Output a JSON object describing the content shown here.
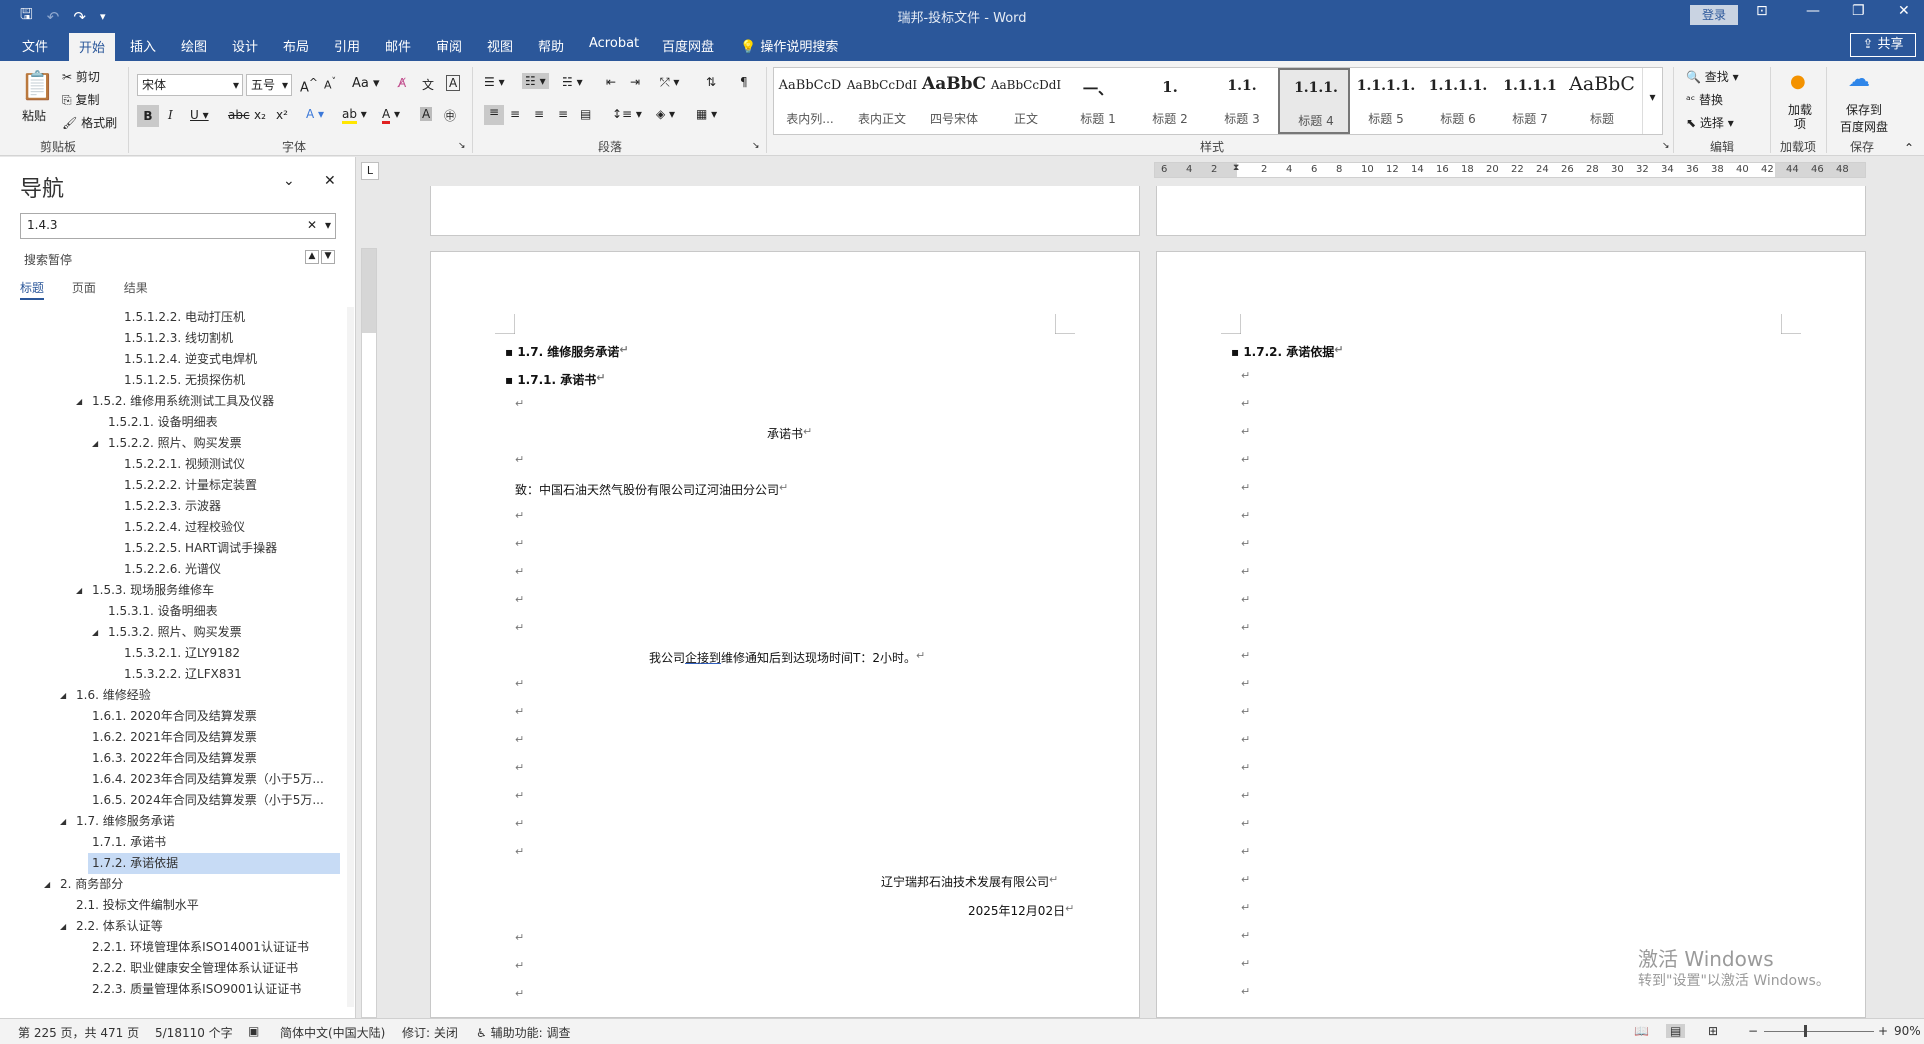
{
  "titlebar": {
    "title": "瑞邦-投标文件 - Word",
    "login": "登录"
  },
  "qat": {
    "save_icon": "save-icon",
    "undo_icon": "undo-icon",
    "redo_icon": "redo-icon",
    "customize_icon": "customize-icon"
  },
  "tabs": [
    "文件",
    "开始",
    "插入",
    "绘图",
    "设计",
    "布局",
    "引用",
    "邮件",
    "审阅",
    "视图",
    "帮助",
    "Acrobat",
    "百度网盘"
  ],
  "active_tab": "开始",
  "tellme": "操作说明搜索",
  "share": "共享",
  "ribbon": {
    "clipboard": {
      "paste": "粘贴",
      "cut": "剪切",
      "copy": "复制",
      "format_painter": "格式刷",
      "label": "剪贴板"
    },
    "font": {
      "name": "宋体",
      "size": "五号",
      "label": "字体"
    },
    "paragraph": {
      "label": "段落"
    },
    "styles": {
      "label": "样式",
      "items": [
        {
          "sample": "AaBbCcD",
          "name": "表内列..."
        },
        {
          "sample": "AaBbCcDdI",
          "name": "表内正文"
        },
        {
          "sample": "AaBbC",
          "name": "四号宋体"
        },
        {
          "sample": "AaBbCcDdI",
          "name": "正文"
        },
        {
          "sample": "一、",
          "name": "标题 1"
        },
        {
          "sample": "1.",
          "name": "标题 2"
        },
        {
          "sample": "1.1.",
          "name": "标题 3"
        },
        {
          "sample": "1.1.1.",
          "name": "标题 4"
        },
        {
          "sample": "1.1.1.1.",
          "name": "标题 5"
        },
        {
          "sample": "1.1.1.1.",
          "name": "标题 6"
        },
        {
          "sample": "1.1.1.1",
          "name": "标题 7"
        },
        {
          "sample": "AaBbC",
          "name": "标题"
        }
      ]
    },
    "editing": {
      "find": "查找",
      "replace": "替换",
      "select": "选择",
      "label": "编辑"
    },
    "addins": {
      "button": "加载项",
      "label": "加载项"
    },
    "save_group": {
      "button_line1": "保存到",
      "button_line2": "百度网盘",
      "label": "保存"
    }
  },
  "nav": {
    "title": "导航",
    "search_value": "1.4.3",
    "status": "搜索暂停",
    "tabs": [
      "标题",
      "页面",
      "结果"
    ],
    "items": [
      {
        "text": "1.5.1.2.2. 电动打压机",
        "level": 5
      },
      {
        "text": "1.5.1.2.3. 线切割机",
        "level": 5
      },
      {
        "text": "1.5.1.2.4. 逆变式电焊机",
        "level": 5
      },
      {
        "text": "1.5.1.2.5. 无损探伤机",
        "level": 5
      },
      {
        "text": "1.5.2. 维修用系统测试工具及仪器",
        "level": 3,
        "toggle": "◢"
      },
      {
        "text": "1.5.2.1. 设备明细表",
        "level": 4
      },
      {
        "text": "1.5.2.2. 照片、购买发票",
        "level": 4,
        "toggle": "◢"
      },
      {
        "text": "1.5.2.2.1. 视频测试仪",
        "level": 5
      },
      {
        "text": "1.5.2.2.2. 计量标定装置",
        "level": 5
      },
      {
        "text": "1.5.2.2.3. 示波器",
        "level": 5
      },
      {
        "text": "1.5.2.2.4. 过程校验仪",
        "level": 5
      },
      {
        "text": "1.5.2.2.5. HART调试手操器",
        "level": 5
      },
      {
        "text": "1.5.2.2.6. 光谱仪",
        "level": 5
      },
      {
        "text": "1.5.3. 现场服务维修车",
        "level": 3,
        "toggle": "◢"
      },
      {
        "text": "1.5.3.1. 设备明细表",
        "level": 4
      },
      {
        "text": "1.5.3.2. 照片、购买发票",
        "level": 4,
        "toggle": "◢"
      },
      {
        "text": "1.5.3.2.1. 辽LY9182",
        "level": 5
      },
      {
        "text": "1.5.3.2.2. 辽LFX831",
        "level": 5
      },
      {
        "text": "1.6. 维修经验",
        "level": 2,
        "toggle": "◢"
      },
      {
        "text": "1.6.1. 2020年合同及结算发票",
        "level": 3
      },
      {
        "text": "1.6.2. 2021年合同及结算发票",
        "level": 3
      },
      {
        "text": "1.6.3. 2022年合同及结算发票",
        "level": 3
      },
      {
        "text": "1.6.4. 2023年合同及结算发票（小于5万...",
        "level": 3
      },
      {
        "text": "1.6.5. 2024年合同及结算发票（小于5万...",
        "level": 3
      },
      {
        "text": "1.7. 维修服务承诺",
        "level": 2,
        "toggle": "◢"
      },
      {
        "text": "1.7.1. 承诺书",
        "level": 3
      },
      {
        "text": "1.7.2. 承诺依据",
        "level": 3,
        "selected": true
      },
      {
        "text": "2. 商务部分",
        "level": 1,
        "toggle": "◢"
      },
      {
        "text": "2.1. 投标文件编制水平",
        "level": 2
      },
      {
        "text": "2.2. 体系认证等",
        "level": 2,
        "toggle": "◢"
      },
      {
        "text": "2.2.1. 环境管理体系ISO14001认证证书",
        "level": 3
      },
      {
        "text": "2.2.2. 职业健康安全管理体系认证证书",
        "level": 3
      },
      {
        "text": "2.2.3. 质量管理体系ISO9001认证证书",
        "level": 3
      }
    ]
  },
  "ruler": {
    "corner": "L",
    "ticks": [
      "6",
      "4",
      "2",
      "",
      "2",
      "4",
      "6",
      "8",
      "10",
      "12",
      "14",
      "16",
      "18",
      "20",
      "22",
      "24",
      "26",
      "28",
      "30",
      "32",
      "34",
      "36",
      "38",
      "40",
      "42",
      "44",
      "46",
      "48"
    ]
  },
  "page_left": {
    "heading1": "1.7. 维修服务承诺",
    "heading2": "1.7.1. 承诺书",
    "title": "承诺书",
    "to": "致：中国石油天然气股份有限公司辽河油田分公司",
    "promise_pre": "我公司",
    "promise_underlined": "企接到",
    "promise_post": "维修通知后到达现场时间T：2小时。",
    "company": "辽宁瑞邦石油技术发展有限公司",
    "date": "2025年12月02日"
  },
  "page_right": {
    "heading": "1.7.2. 承诺依据"
  },
  "para_mark": "↵",
  "watermark": {
    "line1": "激活 Windows",
    "line2": "转到\"设置\"以激活 Windows。"
  },
  "status": {
    "page": "第 225 页，共 471 页",
    "words": "5/18110 个字",
    "language": "简体中文(中国大陆)",
    "track": "修订: 关闭",
    "accessibility": "辅助功能: 调查",
    "zoom": "90%"
  }
}
